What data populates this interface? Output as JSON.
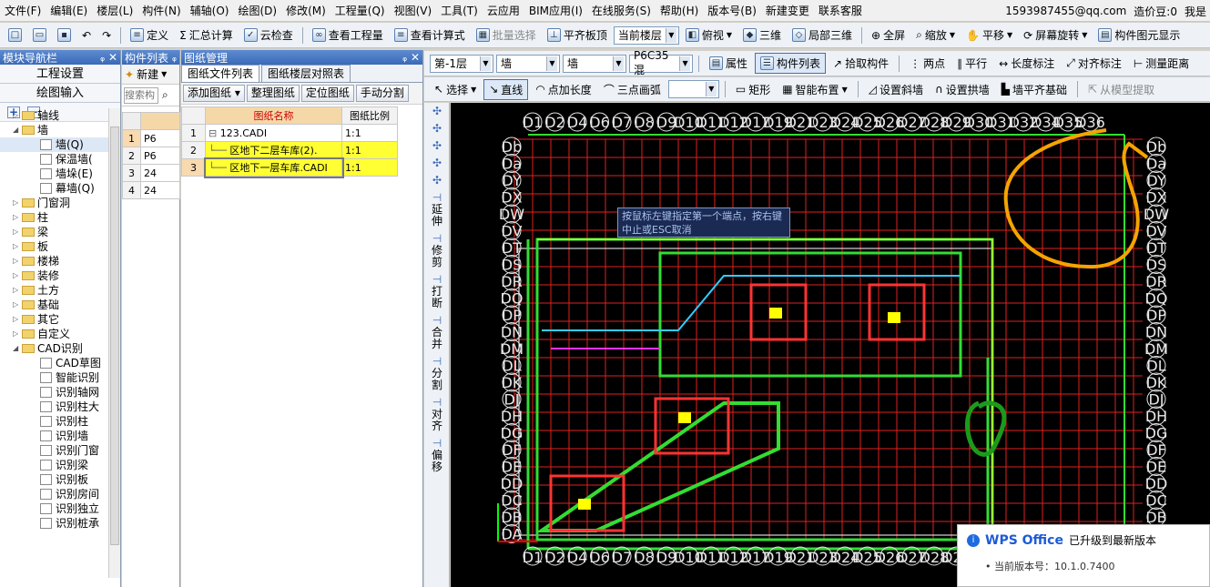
{
  "menu": [
    "文件(F)",
    "编辑(E)",
    "楼层(L)",
    "构件(N)",
    "辅轴(O)",
    "绘图(D)",
    "修改(M)",
    "工程量(Q)",
    "视图(V)",
    "工具(T)",
    "云应用",
    "BIM应用(I)",
    "在线服务(S)",
    "帮助(H)",
    "版本号(B)",
    "新建变更",
    "联系客服"
  ],
  "account": {
    "email": "1593987455@qq.com",
    "points": "造价豆:0",
    "more": "我是"
  },
  "toolbar1": {
    "define": "定义",
    "sum": "汇总计算",
    "cloud_check": "云检查",
    "view_qty": "查看工程量",
    "view_formula": "查看计算式",
    "batch_select": "批量选择",
    "flush_top": "平齐板顶",
    "floor_selector": "当前楼层",
    "top_view": "俯视",
    "three_d": "三维",
    "partial_3d": "局部三维",
    "fullscreen": "全屏",
    "zoom": "缩放",
    "pan": "平移",
    "rotate": "屏幕旋转",
    "component_display": "构件图元显示"
  },
  "nav_panel": {
    "title": "模块导航栏",
    "project_settings": "工程设置",
    "drawing_input": "绘图输入",
    "tree": [
      {
        "label": "轴线",
        "level": 0,
        "type": "folder"
      },
      {
        "label": "墙",
        "level": 0,
        "type": "folder"
      },
      {
        "label": "墙(Q)",
        "level": 1,
        "type": "leaf"
      },
      {
        "label": "保温墙(",
        "level": 1,
        "type": "leaf"
      },
      {
        "label": "墙垛(E)",
        "level": 1,
        "type": "leaf"
      },
      {
        "label": "幕墙(Q)",
        "level": 1,
        "type": "leaf"
      },
      {
        "label": "门窗洞",
        "level": 0,
        "type": "folder"
      },
      {
        "label": "柱",
        "level": 0,
        "type": "folder"
      },
      {
        "label": "梁",
        "level": 0,
        "type": "folder"
      },
      {
        "label": "板",
        "level": 0,
        "type": "folder"
      },
      {
        "label": "楼梯",
        "level": 0,
        "type": "folder"
      },
      {
        "label": "装修",
        "level": 0,
        "type": "folder"
      },
      {
        "label": "土方",
        "level": 0,
        "type": "folder"
      },
      {
        "label": "基础",
        "level": 0,
        "type": "folder"
      },
      {
        "label": "其它",
        "level": 0,
        "type": "folder"
      },
      {
        "label": "自定义",
        "level": 0,
        "type": "folder"
      },
      {
        "label": "CAD识别",
        "level": 0,
        "type": "folder"
      },
      {
        "label": "CAD草图",
        "level": 1,
        "type": "leaf"
      },
      {
        "label": "智能识别",
        "level": 1,
        "type": "leaf"
      },
      {
        "label": "识别轴网",
        "level": 1,
        "type": "leaf"
      },
      {
        "label": "识别柱大",
        "level": 1,
        "type": "leaf"
      },
      {
        "label": "识别柱",
        "level": 1,
        "type": "leaf"
      },
      {
        "label": "识别墙",
        "level": 1,
        "type": "leaf"
      },
      {
        "label": "识别门窗",
        "level": 1,
        "type": "leaf"
      },
      {
        "label": "识别梁",
        "level": 1,
        "type": "leaf"
      },
      {
        "label": "识别板",
        "level": 1,
        "type": "leaf"
      },
      {
        "label": "识别房间",
        "level": 1,
        "type": "leaf"
      },
      {
        "label": "识别独立",
        "level": 1,
        "type": "leaf"
      },
      {
        "label": "识别桩承",
        "level": 1,
        "type": "leaf"
      }
    ]
  },
  "component_panel": {
    "title": "构件列表",
    "new": "新建",
    "search": "搜索构",
    "rows": [
      "1",
      "2",
      "3",
      "4"
    ],
    "cells": [
      "P6",
      "P6",
      "24",
      "24"
    ]
  },
  "drawing_panel": {
    "title": "图纸管理",
    "tabs": [
      "图纸文件列表",
      "图纸楼层对照表"
    ],
    "buttons": [
      "添加图纸",
      "整理图纸",
      "定位图纸",
      "手动分割"
    ],
    "headers": [
      "图纸名称",
      "图纸比例"
    ],
    "rows": [
      {
        "num": "1",
        "name": "123.CADI",
        "scale": "1:1"
      },
      {
        "num": "2",
        "name": "区地下二层车库(2).",
        "scale": "1:1"
      },
      {
        "num": "3",
        "name": "区地下一层车库.CADI",
        "scale": "1:1"
      }
    ]
  },
  "toolbar2": {
    "floor": "第-1层",
    "type1": "墙",
    "type2": "墙",
    "material": "P6C35混",
    "property": "属性",
    "comp_list": "构件列表",
    "pick": "拾取构件",
    "two_point": "两点",
    "parallel": "平行",
    "dimension": "长度标注",
    "align_dim": "对齐标注",
    "measure": "测量距离"
  },
  "toolbar3": {
    "select": "选择",
    "line": "直线",
    "point_len": "点加长度",
    "arc3": "三点画弧",
    "rect": "矩形",
    "smart": "智能布置",
    "slope_wall": "设置斜墙",
    "arch_wall": "设置拱墙",
    "align_base": "墙平齐基础",
    "from_model": "从模型提取"
  },
  "side_tools": [
    "延伸",
    "修剪",
    "打断",
    "合并",
    "分割",
    "对齐",
    "偏移"
  ],
  "axis_top": [
    "D1",
    "D2",
    "D4",
    "D6",
    "D7",
    "D8",
    "D9",
    "D10",
    "D11",
    "D12",
    "D17",
    "D19",
    "D21",
    "D23",
    "D24",
    "D25",
    "D26",
    "D27",
    "D28",
    "D29",
    "D30",
    "D31",
    "D32",
    "D34",
    "D35",
    "D36"
  ],
  "axis_right": [
    "Db",
    "Da",
    "DY",
    "DX",
    "DW",
    "DV",
    "DT",
    "DS",
    "DR",
    "DQ",
    "DP",
    "DN",
    "DM",
    "DL",
    "DK",
    "DJ",
    "DH",
    "DG",
    "DF",
    "DE",
    "DD",
    "DC",
    "DB",
    "DA"
  ],
  "tooltip": "按鼠标左键指定第一个端点，按右键中止或ESC取消",
  "wps": {
    "brand": "WPS Office",
    "msg": "已升级到最新版本",
    "version_label": "当前版本号：",
    "version": "10.1.0.7400"
  },
  "colors": {
    "canvas_bg": "#000000",
    "grid": "#e02020",
    "wall": "#33dd33",
    "axis": "#e8e8e8",
    "orange_mark": "#f5a400",
    "green_mark": "#1c9a1c"
  }
}
